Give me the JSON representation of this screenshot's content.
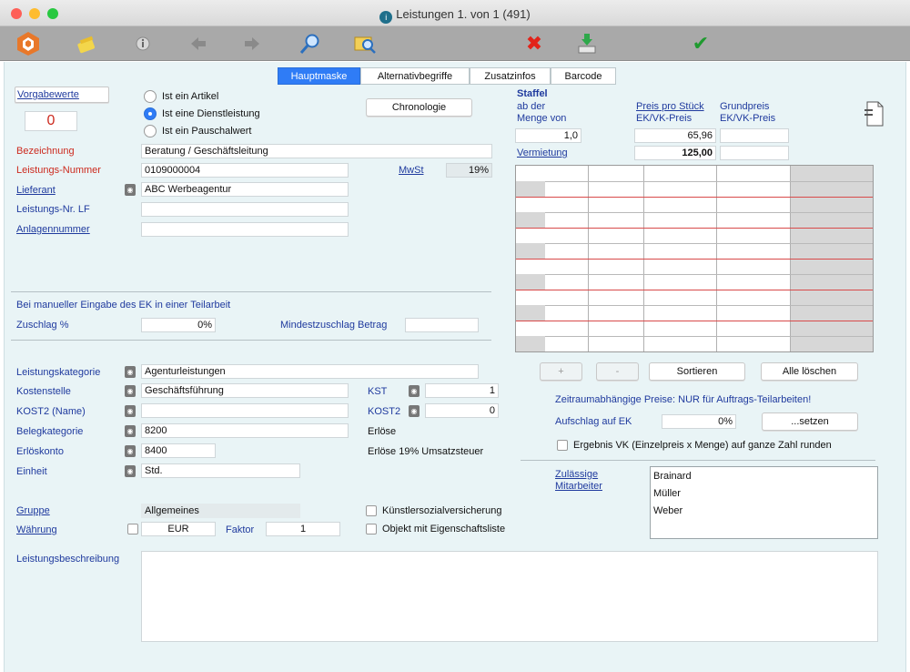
{
  "window": {
    "title": "Leistungen 1. von 1 (491)"
  },
  "toolbar": {
    "icons": [
      "app-logo-icon",
      "edit-icon",
      "info-icon",
      "arrow-left-icon",
      "arrow-right-icon",
      "search-icon",
      "find-folder-icon",
      "delete-icon",
      "import-icon",
      "confirm-icon"
    ]
  },
  "tabs": [
    {
      "label": "Hauptmaske",
      "active": true
    },
    {
      "label": "Alternativbegriffe"
    },
    {
      "label": "Zusatzinfos"
    },
    {
      "label": "Barcode"
    }
  ],
  "left": {
    "vorgabewerte": "Vorgabewerte",
    "counter": "0",
    "radios": [
      {
        "label": "Ist ein Artikel",
        "selected": false
      },
      {
        "label": "Ist eine Dienstleistung",
        "selected": true
      },
      {
        "label": "Ist ein Pauschalwert",
        "selected": false
      }
    ],
    "chronologie": "Chronologie",
    "bezeichnung_label": "Bezeichnung",
    "bezeichnung_value": "Beratung / Geschäftsleitung",
    "leistungsnummer_label": "Leistungs-Nummer",
    "leistungsnummer_value": "0109000004",
    "mwst_label": "MwSt",
    "mwst_value": "19%",
    "lieferant_label": "Lieferant",
    "lieferant_value": "ABC Werbeagentur",
    "leistungsnr_lf_label": "Leistungs-Nr. LF",
    "leistungsnr_lf_value": "",
    "anlagennummer_label": "Anlagennummer",
    "anlagennummer_value": "",
    "manual_ek_heading": "Bei manueller Eingabe des EK in einer Teilarbeit",
    "zuschlag_label": "Zuschlag %",
    "zuschlag_value": "0%",
    "mindestzuschlag_label": "Mindestzuschlag Betrag",
    "mindestzuschlag_value": "",
    "leistungskategorie_label": "Leistungskategorie",
    "leistungskategorie_value": "Agenturleistungen",
    "kostenstelle_label": "Kostenstelle",
    "kostenstelle_value": "Geschäftsführung",
    "kst_label": "KST",
    "kst_value": "1",
    "kost2name_label": "KOST2 (Name)",
    "kost2name_value": "",
    "kost2_label": "KOST2",
    "kost2_value": "0",
    "belegkategorie_label": "Belegkategorie",
    "belegkategorie_value": "8200",
    "erloese_label": "Erlöse",
    "erloeskonto_label": "Erlöskonto",
    "erloeskonto_value": "8400",
    "erloese_text": "Erlöse 19% Umsatzsteuer",
    "einheit_label": "Einheit",
    "einheit_value": "Std.",
    "gruppe_label": "Gruppe",
    "gruppe_value": "Allgemeines",
    "kuenstler_label": "Künstlersozialversicherung",
    "waehrung_label": "Währung",
    "waehrung_value": "EUR",
    "faktor_label": "Faktor",
    "faktor_value": "1",
    "objekt_label": "Objekt mit Eigenschaftsliste",
    "beschreibung_label": "Leistungsbeschreibung",
    "beschreibung_value": ""
  },
  "right": {
    "staffel_label": "Staffel",
    "ab_der_label": "ab der",
    "menge_von_label": "Menge von",
    "preis_pro_stueck_label": "Preis pro Stück",
    "ek_vk_preis_label": "EK/VK-Preis",
    "grundpreis_label": "Grundpreis",
    "ek_vk_preis2_label": "EK/VK-Preis",
    "menge_value": "1,0",
    "preis_value": "65,96",
    "grundpreis_value": "",
    "vermietung_label": "Vermietung",
    "vermietung_value": "125,00",
    "grid_rows": 12,
    "plus_btn": "+",
    "minus_btn": "-",
    "sortieren_btn": "Sortieren",
    "alle_loeschen_btn": "Alle löschen",
    "zeitraum_text": "Zeitraumabhängige Preise: NUR für Auftrags-Teilarbeiten!",
    "aufschlag_label": "Aufschlag auf EK",
    "aufschlag_value": "0%",
    "setzen_btn": "...setzen",
    "runden_label": "Ergebnis VK (Einzelpreis x Menge) auf ganze Zahl runden",
    "mitarbeiter_label_1": "Zulässige",
    "mitarbeiter_label_2": "Mitarbeiter",
    "mitarbeiter": [
      "Brainard",
      "Müller",
      "Weber"
    ]
  },
  "colors": {
    "accent": "#2f7cf6",
    "link": "#1f3a9e",
    "required": "#cc2a1e",
    "panel": "#e9f4f6",
    "toolbar": "#a9a9a9"
  }
}
